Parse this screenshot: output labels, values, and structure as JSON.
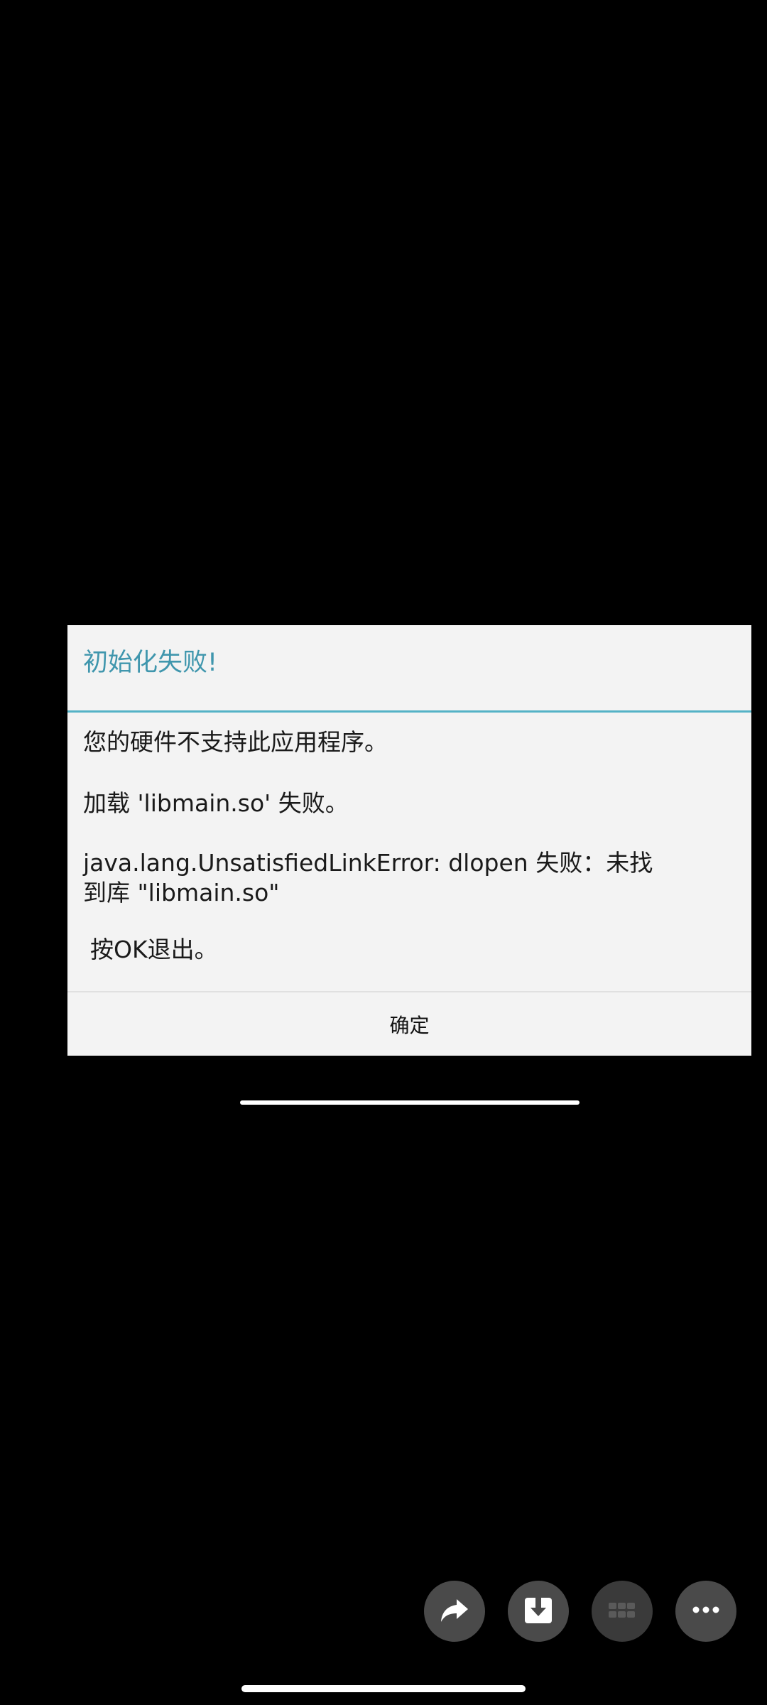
{
  "dialog": {
    "title": "初始化失败!",
    "messages": [
      "您的硬件不支持此应用程序。",
      "加载 'libmain.so' 失败。",
      "java.lang.UnsatisfiedLinkError: dlopen 失败：未找到库 \"libmain.so\"",
      "按OK退出。"
    ],
    "confirm_label": "确定"
  },
  "actions": [
    {
      "icon": "share-icon"
    },
    {
      "icon": "download-icon"
    },
    {
      "icon": "grid-icon"
    },
    {
      "icon": "more-icon"
    }
  ],
  "colors": {
    "title": "#3f96ad",
    "divider": "#54b2c6",
    "dialog_bg": "#f3f3f3",
    "action_bg": "#4a4a4a"
  }
}
